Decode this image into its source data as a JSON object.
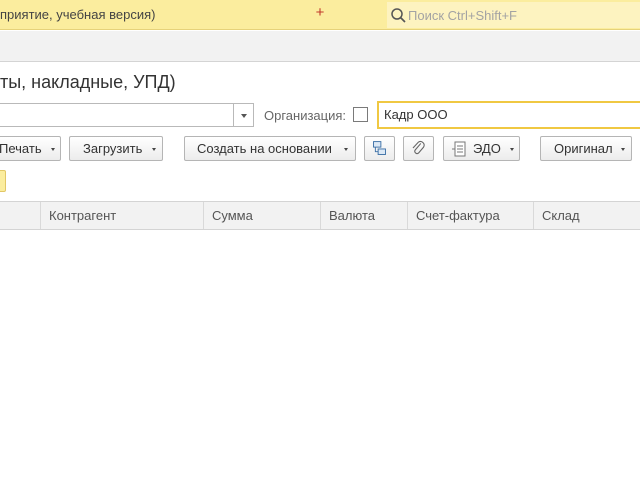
{
  "titlebar": {
    "app_title": "приятие, учебная версия)",
    "plus_icon": "+",
    "search_placeholder": "Поиск Ctrl+Shift+F"
  },
  "page": {
    "title": "ты, накладные, УПД)"
  },
  "filters": {
    "combo_value": "",
    "org_label": "Организация:",
    "org_checked": false,
    "org_value": "Кадр ООО"
  },
  "toolbar": {
    "print_label": "Печать",
    "load_label": "Загрузить",
    "create_based_label": "Создать на основании",
    "structure_icon": "structure-icon",
    "attach_icon": "paperclip-icon",
    "edo_label": "ЭДО",
    "original_label": "Оригинал"
  },
  "table": {
    "columns": [
      "Контрагент",
      "Сумма",
      "Валюта",
      "Счет-фактура",
      "Склад"
    ],
    "rows": []
  },
  "colors": {
    "titlebar_bg": "#fbed9e",
    "accent_border": "#f0c842",
    "header_bg": "#f2f2f2"
  }
}
